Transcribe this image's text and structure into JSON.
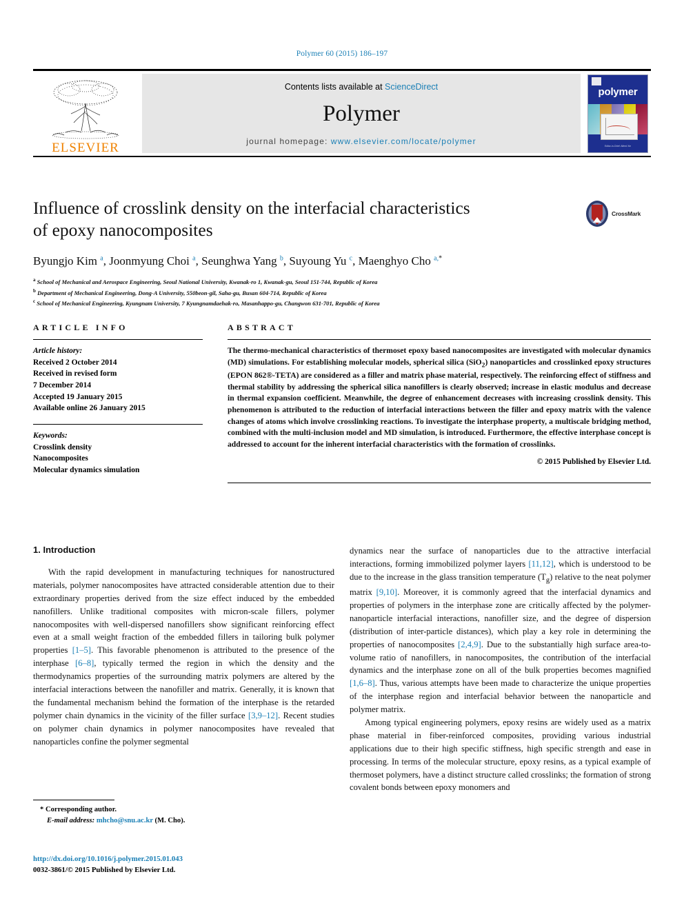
{
  "running_head": "Polymer 60 (2015) 186–197",
  "masthead": {
    "publisher_name": "ELSEVIER",
    "contents_prefix": "Contents lists available at ",
    "contents_link": "ScienceDirect",
    "journal_title": "Polymer",
    "homepage_prefix": "journal homepage: ",
    "homepage_url": "www.elsevier.com/locate/polymer",
    "cover_journal_name": "polymer",
    "cover_footer": "Editor-in-Chief: Alfred Xie"
  },
  "article": {
    "title_line1": "Influence of crosslink density on the interfacial characteristics",
    "title_line2": "of epoxy nanocomposites",
    "crossmark_label": "CrossMark",
    "authors": [
      {
        "name": "Byungjo Kim",
        "marks": "a"
      },
      {
        "name": "Joonmyung Choi",
        "marks": "a"
      },
      {
        "name": "Seunghwa Yang",
        "marks": "b"
      },
      {
        "name": "Suyoung Yu",
        "marks": "c"
      },
      {
        "name": "Maenghyo Cho",
        "marks": "a,",
        "star": "*"
      }
    ],
    "affiliations": [
      {
        "mark": "a",
        "text": "School of Mechanical and Aerospace Engineering, Seoul National University, Kwanak-ro 1, Kwanak-gu, Seoul 151-744, Republic of Korea"
      },
      {
        "mark": "b",
        "text": "Department of Mechanical Engineering, Dong-A University, 550beon-gil, Saha-gu, Busan 604-714, Republic of Korea"
      },
      {
        "mark": "c",
        "text": "School of Mechanical Engineering, Kyungnam University, 7 Kyungnamdaehak-ro, Masanhappo-gu, Changwon 631-701, Republic of Korea"
      }
    ]
  },
  "article_info": {
    "heading": "ARTICLE INFO",
    "history_label": "Article history:",
    "history": [
      "Received 2 October 2014",
      "Received in revised form",
      "7 December 2014",
      "Accepted 19 January 2015",
      "Available online 26 January 2015"
    ],
    "keywords_label": "Keywords:",
    "keywords": [
      "Crosslink density",
      "Nanocomposites",
      "Molecular dynamics simulation"
    ]
  },
  "abstract": {
    "heading": "ABSTRACT",
    "text": "The thermo-mechanical characteristics of thermoset epoxy based nanocomposites are investigated with molecular dynamics (MD) simulations. For establishing molecular models, spherical silica (SiO2) nanoparticles and crosslinked epoxy structures (EPON 862®-TETA) are considered as a filler and matrix phase material, respectively. The reinforcing effect of stiffness and thermal stability by addressing the spherical silica nanofillers is clearly observed; increase in elastic modulus and decrease in thermal expansion coefficient. Meanwhile, the degree of enhancement decreases with increasing crosslink density. This phenomenon is attributed to the reduction of interfacial interactions between the filler and epoxy matrix with the valence changes of atoms which involve crosslinking reactions. To investigate the interphase property, a multiscale bridging method, combined with the multi-inclusion model and MD simulation, is introduced. Furthermore, the effective interphase concept is addressed to account for the inherent interfacial characteristics with the formation of crosslinks.",
    "copyright": "© 2015 Published by Elsevier Ltd."
  },
  "body": {
    "section_heading": "1. Introduction",
    "left_paragraph_1": "With the rapid development in manufacturing techniques for nanostructured materials, polymer nanocomposites have attracted considerable attention due to their extraordinary properties derived from the size effect induced by the embedded nanofillers. Unlike traditional composites with micron-scale fillers, polymer nanocomposites with well-dispersed nanofillers show significant reinforcing effect even at a small weight fraction of the embedded fillers in tailoring bulk polymer properties [1–5]. This favorable phenomenon is attributed to the presence of the interphase [6–8], typically termed the region in which the density and the thermodynamics properties of the surrounding matrix polymers are altered by the interfacial interactions between the nanofiller and matrix. Generally, it is known that the fundamental mechanism behind the formation of the interphase is the retarded polymer chain dynamics in the vicinity of the filler surface [3,9–12]. Recent studies on polymer chain dynamics in polymer nanocomposites have revealed that nanoparticles confine the polymer segmental",
    "right_paragraph_1": "dynamics near the surface of nanoparticles due to the attractive interfacial interactions, forming immobilized polymer layers [11,12], which is understood to be due to the increase in the glass transition temperature (Tg) relative to the neat polymer matrix [9,10]. Moreover, it is commonly agreed that the interfacial dynamics and properties of polymers in the interphase zone are critically affected by the polymer-nanoparticle interfacial interactions, nanofiller size, and the degree of dispersion (distribution of inter-particle distances), which play a key role in determining the properties of nanocomposites [2,4,9]. Due to the substantially high surface area-to-volume ratio of nanofillers, in nanocomposites, the contribution of the interfacial dynamics and the interphase zone on all of the bulk properties becomes magnified [1,6–8]. Thus, various attempts have been made to characterize the unique properties of the interphase region and interfacial behavior between the nanoparticle and polymer matrix.",
    "right_paragraph_2": "Among typical engineering polymers, epoxy resins are widely used as a matrix phase material in fiber-reinforced composites, providing various industrial applications due to their high specific stiffness, high specific strength and ease in processing. In terms of the molecular structure, epoxy resins, as a typical example of thermoset polymers, have a distinct structure called crosslinks; the formation of strong covalent bonds between epoxy monomers and"
  },
  "footnote": {
    "corresponding_marker": "*",
    "corresponding_text": "Corresponding author.",
    "email_label": "E-mail address:",
    "email": "mhcho@snu.ac.kr",
    "email_suffix": "(M. Cho)."
  },
  "publication_footer": {
    "doi": "http://dx.doi.org/10.1016/j.polymer.2015.01.043",
    "issn_line": "0032-3861/© 2015 Published by Elsevier Ltd."
  },
  "colors": {
    "link": "#1a7fb5",
    "elsevier_orange": "#ef8200",
    "cover_blue": "#1d2f8f"
  }
}
